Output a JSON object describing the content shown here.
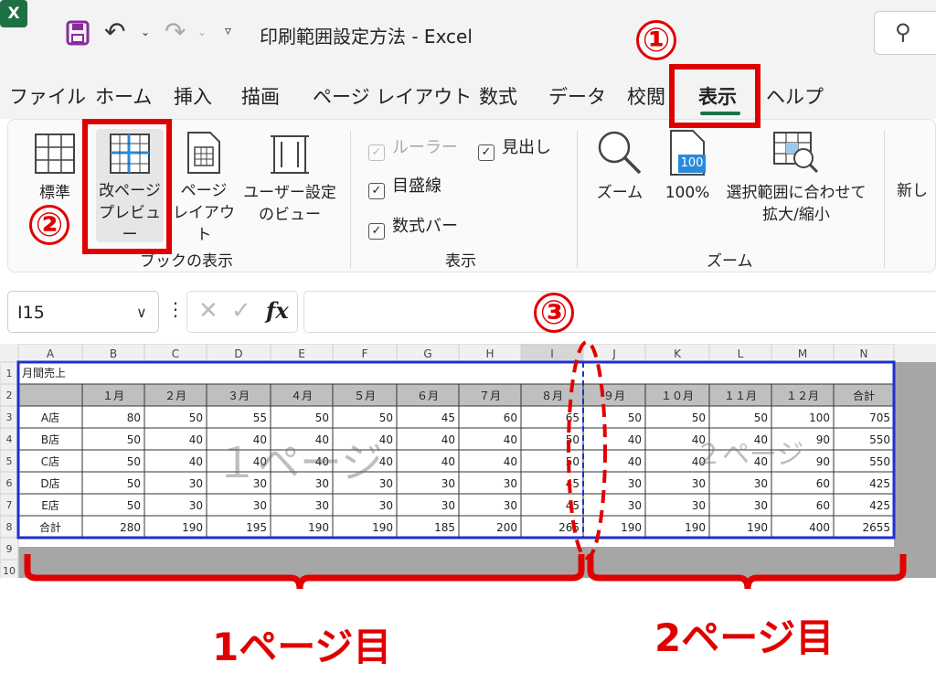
{
  "titlebar": {
    "app_logo": "X",
    "title": "印刷範囲設定方法  -  Excel",
    "icons": [
      "excel-logo",
      "save-icon",
      "undo-icon",
      "redo-icon",
      "customize-qat-icon",
      "search-icon"
    ]
  },
  "tabs": [
    {
      "label": "ファイル",
      "active": false
    },
    {
      "label": "ホーム",
      "active": false
    },
    {
      "label": "挿入",
      "active": false
    },
    {
      "label": "描画",
      "active": false
    },
    {
      "label": "ページ レイアウト",
      "active": false
    },
    {
      "label": "数式",
      "active": false
    },
    {
      "label": "データ",
      "active": false
    },
    {
      "label": "校閲",
      "active": false
    },
    {
      "label": "表示",
      "active": true
    },
    {
      "label": "ヘルプ",
      "active": false
    }
  ],
  "ribbon": {
    "workbook_views": {
      "group_label": "ブックの表示",
      "normal": "標準",
      "page_break_preview": [
        "改ページ",
        "プレビュー"
      ],
      "page_layout": [
        "ページ",
        "レイアウト"
      ],
      "custom_views": [
        "ユーザー設定",
        "のビュー"
      ]
    },
    "show": {
      "group_label": "表示",
      "ruler": "ルーラー",
      "gridlines": "目盛線",
      "formula_bar": "数式バー",
      "headings": "見出し"
    },
    "zoom": {
      "group_label": "ズーム",
      "zoom": "ズーム",
      "zoom_100": "100%",
      "icon_100": "100",
      "zoom_to_selection": [
        "選択範囲に合わせて",
        "拡大/縮小"
      ],
      "new_window_partial": "新し"
    }
  },
  "formula_bar": {
    "name_box": "I15",
    "fx": "fx",
    "formula": ""
  },
  "sheet": {
    "column_headers": [
      "A",
      "B",
      "C",
      "D",
      "E",
      "F",
      "G",
      "H",
      "I",
      "J",
      "K",
      "L",
      "M",
      "N"
    ],
    "row_headers": [
      "1",
      "2",
      "3",
      "4",
      "5",
      "6",
      "7",
      "8",
      "9",
      "10"
    ],
    "title_cell": "月間売上",
    "header_row": [
      "",
      "１月",
      "２月",
      "３月",
      "４月",
      "５月",
      "６月",
      "７月",
      "８月",
      "９月",
      "１０月",
      "１１月",
      "１２月",
      "合計"
    ],
    "rows": [
      [
        "A店",
        "80",
        "50",
        "55",
        "50",
        "50",
        "45",
        "60",
        "65",
        "50",
        "50",
        "50",
        "100",
        "705"
      ],
      [
        "B店",
        "50",
        "40",
        "40",
        "40",
        "40",
        "40",
        "40",
        "50",
        "40",
        "40",
        "40",
        "90",
        "550"
      ],
      [
        "C店",
        "50",
        "40",
        "40",
        "40",
        "40",
        "40",
        "40",
        "50",
        "40",
        "40",
        "40",
        "90",
        "550"
      ],
      [
        "D店",
        "50",
        "30",
        "30",
        "30",
        "30",
        "30",
        "30",
        "45",
        "30",
        "30",
        "30",
        "60",
        "425"
      ],
      [
        "E店",
        "50",
        "30",
        "30",
        "30",
        "30",
        "30",
        "30",
        "45",
        "30",
        "30",
        "30",
        "60",
        "425"
      ],
      [
        "合計",
        "280",
        "190",
        "195",
        "190",
        "190",
        "185",
        "200",
        "265",
        "190",
        "190",
        "190",
        "400",
        "2655"
      ]
    ],
    "page1_watermark": "１ページ",
    "page2_watermark": "２ページ"
  },
  "annotations": {
    "step1": "①",
    "step2": "②",
    "step3": "③",
    "page1_label": "1ページ目",
    "page2_label": "2ページ目",
    "color": "#e00000"
  },
  "colors": {
    "accent_green": "#1d7044",
    "page_border_blue": "#1f2fd0",
    "header_gray": "#bfbfbf",
    "outside_gray": "#a6a6a6"
  }
}
